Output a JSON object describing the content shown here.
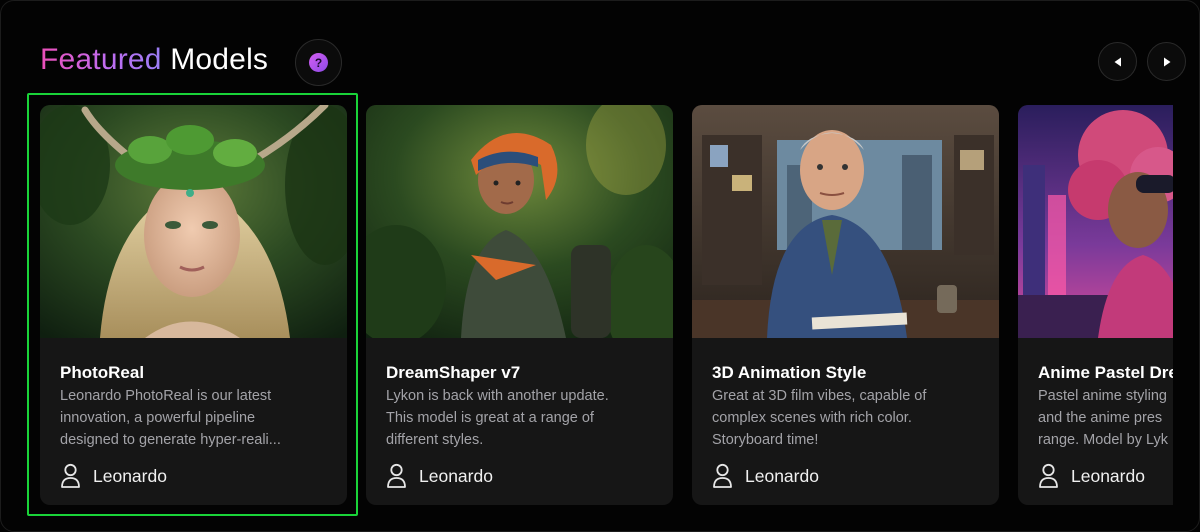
{
  "section": {
    "title_highlight": "Featured",
    "title_rest": " Models",
    "help_icon_glyph": "?",
    "title_gradient": [
      "#ec4fb8",
      "#9b7ef7"
    ]
  },
  "navigation": {
    "prev_icon": "triangle-left-icon",
    "next_icon": "triangle-right-icon"
  },
  "models": [
    {
      "name": "PhotoReal",
      "description": [
        "Leonardo PhotoReal is our latest",
        "innovation, a powerful pipeline",
        "designed to generate hyper-reali..."
      ],
      "author": "Leonardo",
      "selected": true
    },
    {
      "name": "DreamShaper v7",
      "description": [
        "Lykon is back with another update.",
        "This model is great at a range of",
        "different styles."
      ],
      "author": "Leonardo",
      "selected": false
    },
    {
      "name": "3D Animation Style",
      "description": [
        "Great at 3D film vibes, capable of",
        "complex scenes with rich color.",
        "Storyboard time!"
      ],
      "author": "Leonardo",
      "selected": false
    },
    {
      "name": "Anime Pastel Dre",
      "description": [
        "Pastel anime styling",
        "and the anime pres",
        "range. Model by Lyk"
      ],
      "author": "Leonardo",
      "selected": false
    }
  ],
  "colors": {
    "selection_outline": "#19d338",
    "card_background": "#161616",
    "page_background": "#030303"
  }
}
